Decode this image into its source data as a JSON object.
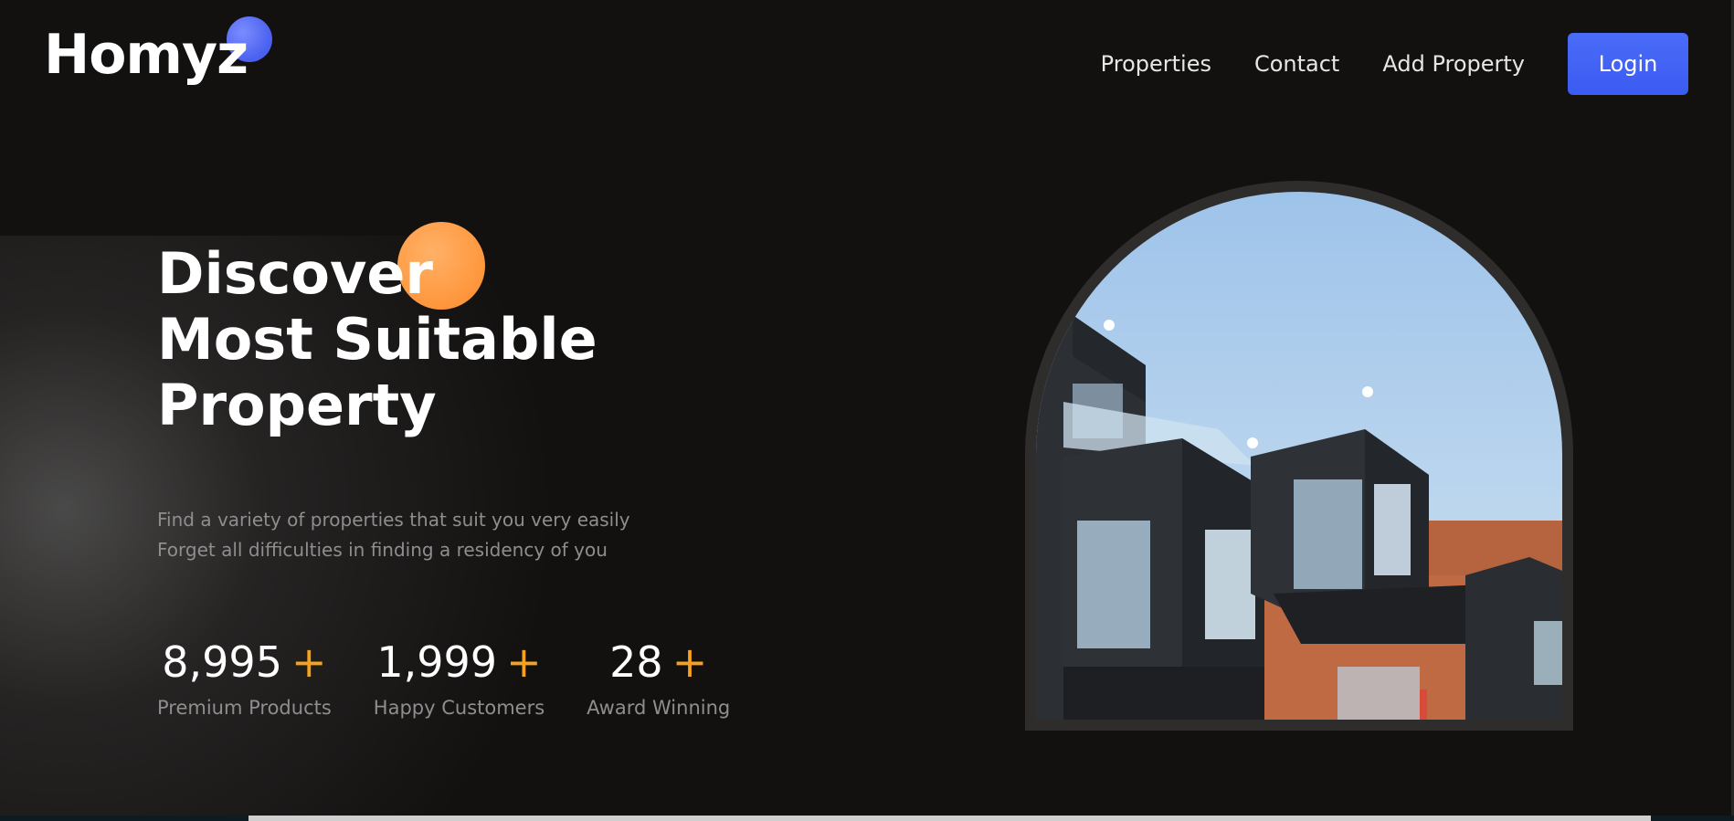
{
  "logo": {
    "text": "Homyz"
  },
  "nav": {
    "links": [
      "Properties",
      "Contact",
      "Add Property"
    ],
    "login_label": "Login"
  },
  "hero": {
    "headline": [
      "Discover",
      "Most Suitable",
      "Property"
    ],
    "subtext": [
      "Find a variety of properties that suit you very easily",
      "Forget all difficulties in finding a residency of you"
    ],
    "stats": [
      {
        "value": "8,995",
        "plus": "+",
        "label": "Premium Products"
      },
      {
        "value": "1,999",
        "plus": "+",
        "label": "Happy Customers"
      },
      {
        "value": "28",
        "plus": "+",
        "label": "Award Winning"
      }
    ],
    "image_alt": "modern building balconies"
  },
  "colors": {
    "background": "#131110",
    "accent_blue": "#4066ff",
    "accent_orange": "#f6a21e",
    "muted_text": "#8e8e8e"
  }
}
